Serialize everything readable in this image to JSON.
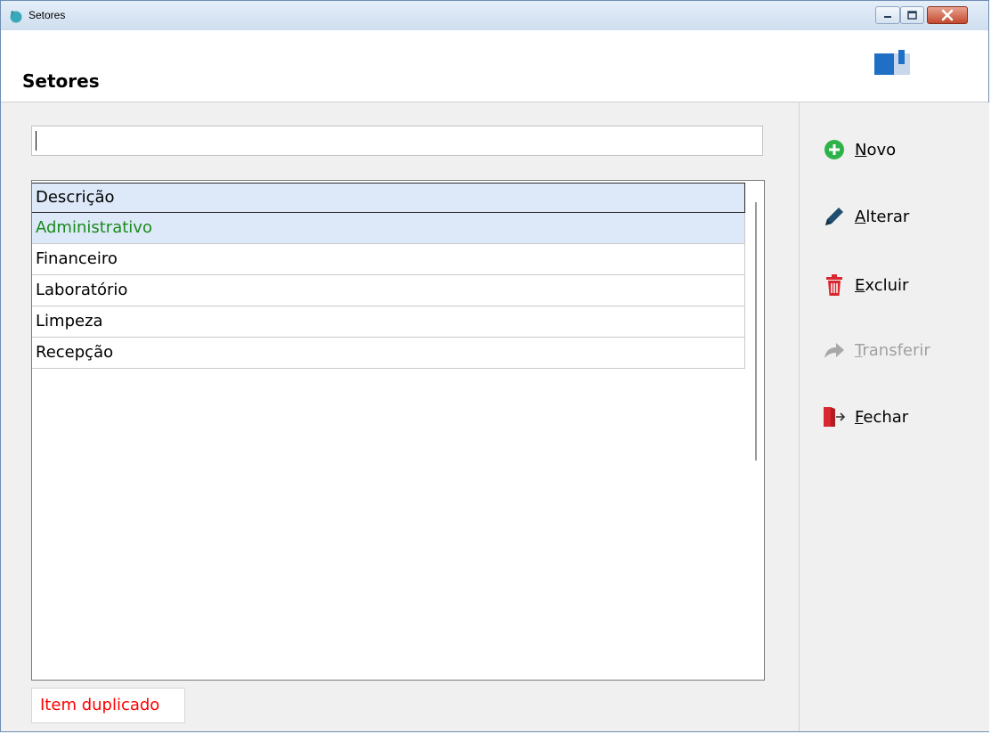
{
  "window": {
    "title": "Setores",
    "controls": [
      "minimize",
      "maximize",
      "close"
    ]
  },
  "header": {
    "title": "Setores",
    "brand_icon": "book-icon"
  },
  "search": {
    "value": "",
    "placeholder": ""
  },
  "table": {
    "column_header": "Descrição",
    "rows": [
      {
        "label": "Administrativo",
        "selected": true
      },
      {
        "label": "Financeiro",
        "selected": false
      },
      {
        "label": "Laboratório",
        "selected": false
      },
      {
        "label": "Limpeza",
        "selected": false
      },
      {
        "label": "Recepção",
        "selected": false
      }
    ]
  },
  "status": {
    "message": "Item duplicado",
    "color": "#ff0000"
  },
  "actions": [
    {
      "accel": "N",
      "rest": "ovo",
      "icon": "plus-circle-icon",
      "enabled": true
    },
    {
      "accel": "A",
      "rest": "lterar",
      "icon": "pencil-icon",
      "enabled": true
    },
    {
      "accel": "E",
      "rest": "xcluir",
      "icon": "trash-icon",
      "enabled": true
    },
    {
      "accel": "T",
      "rest": "ransferir",
      "icon": "share-arrow-icon",
      "enabled": false
    },
    {
      "accel": "F",
      "rest": "echar",
      "icon": "exit-door-icon",
      "enabled": true
    }
  ],
  "colors": {
    "selected_row_bg": "#dde9f9",
    "selected_row_text": "#1a8a1a",
    "accent_green": "#2fb24a",
    "accent_red": "#d9262f",
    "pencil": "#1f4e6e"
  }
}
